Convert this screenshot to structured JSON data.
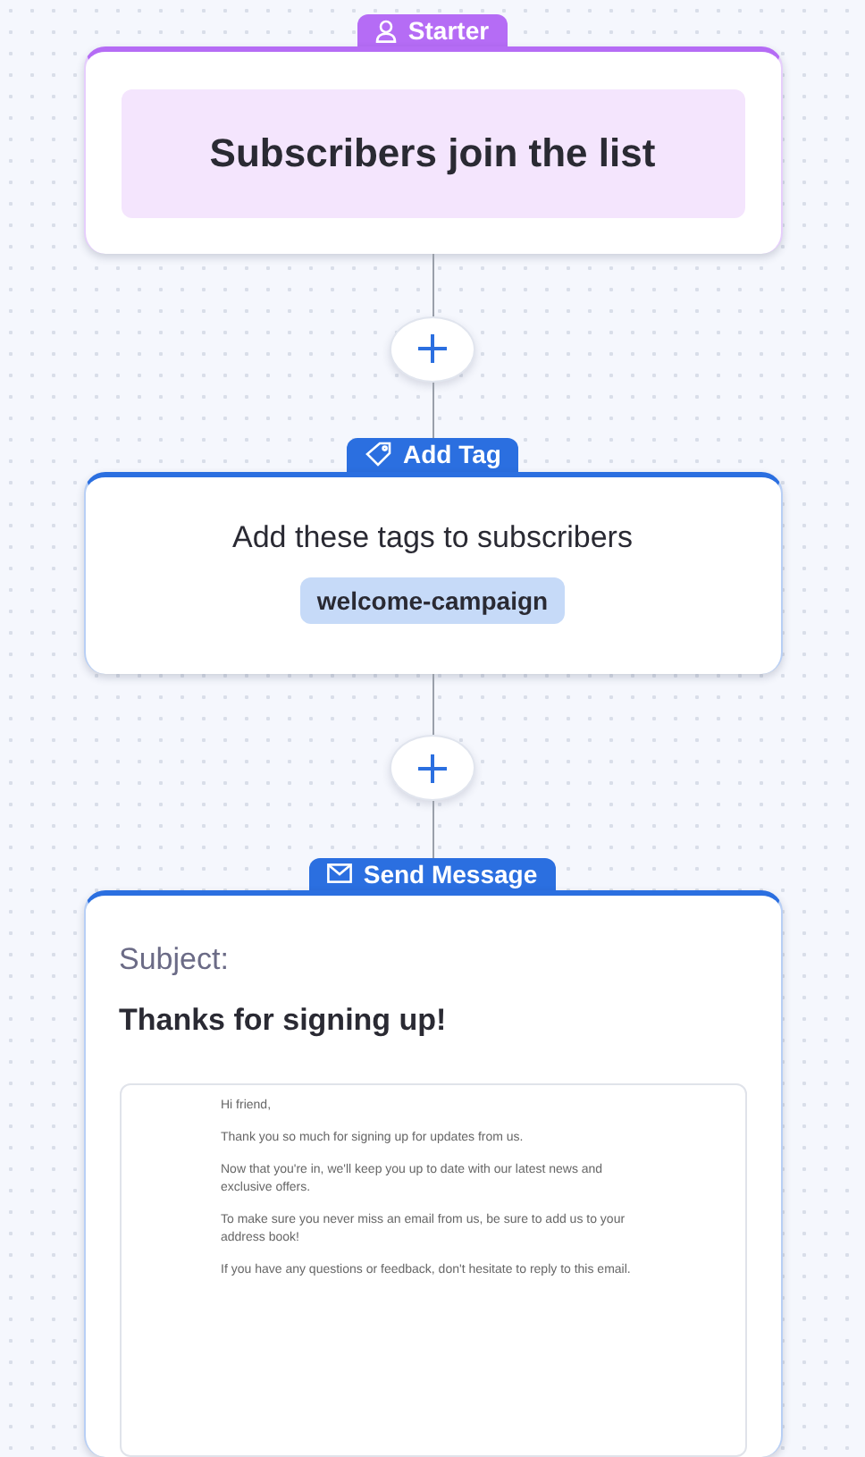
{
  "steps": [
    {
      "kind": "starter",
      "badge": "Starter",
      "title": "Subscribers join the list"
    },
    {
      "kind": "add_tag",
      "badge": "Add Tag",
      "title": "Add these tags to subscribers",
      "tags": [
        "welcome-campaign"
      ]
    },
    {
      "kind": "send_message",
      "badge": "Send Message",
      "subject_label": "Subject:",
      "subject": "Thanks for signing up!",
      "body": [
        "Hi friend,",
        "Thank you so much for signing up for updates from us.",
        "Now that you're in, we'll keep you up to date with our latest news and exclusive offers.",
        "To make sure you never miss an email from us, be sure to add us to your address book!",
        "If you have any questions or feedback, don't hesitate to reply to this email."
      ]
    }
  ]
}
